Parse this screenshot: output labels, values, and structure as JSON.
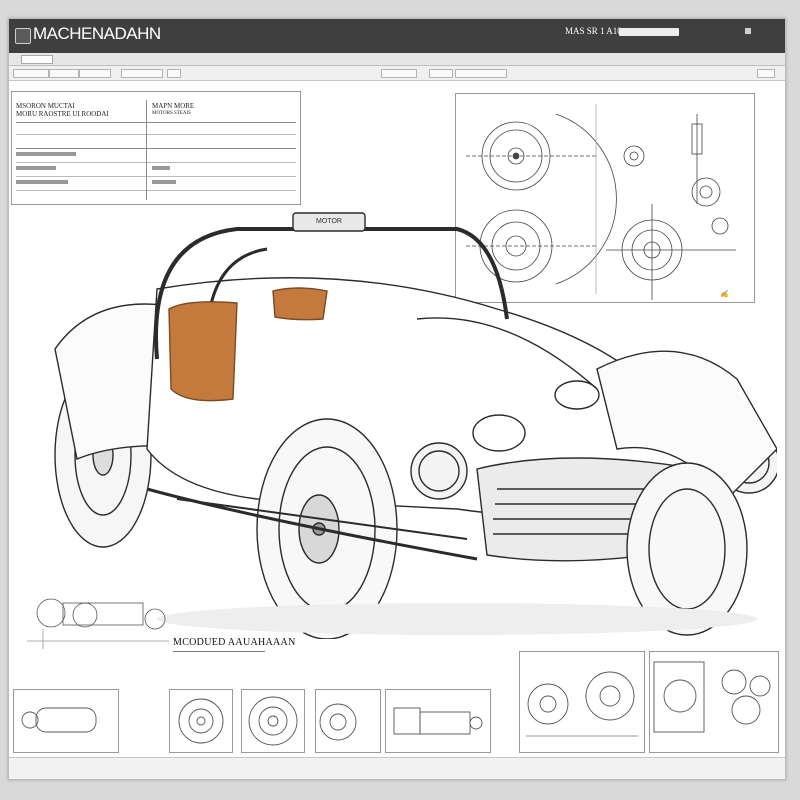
{
  "window": {
    "title": "MACHENADAHN",
    "right_label": "MAS SR 1 A10"
  },
  "spec_sheet": {
    "heading_left": "MSORON MUCTAI",
    "heading_left_sub": "MORU RAOSTRE UI ROODAI",
    "heading_right": "MAPN MORE",
    "heading_right_sub": "MOTORS STEAIS"
  },
  "car_badge": "MOTOR",
  "caption": {
    "title": "MCODUED AAUAHAAAN"
  },
  "icons": {
    "app": "app-icon",
    "close": "close-icon",
    "search": "search-icon"
  },
  "colors": {
    "titlebar": "#3f3f3f",
    "seat": "#c47a3c",
    "outline": "#2b2b2b"
  }
}
